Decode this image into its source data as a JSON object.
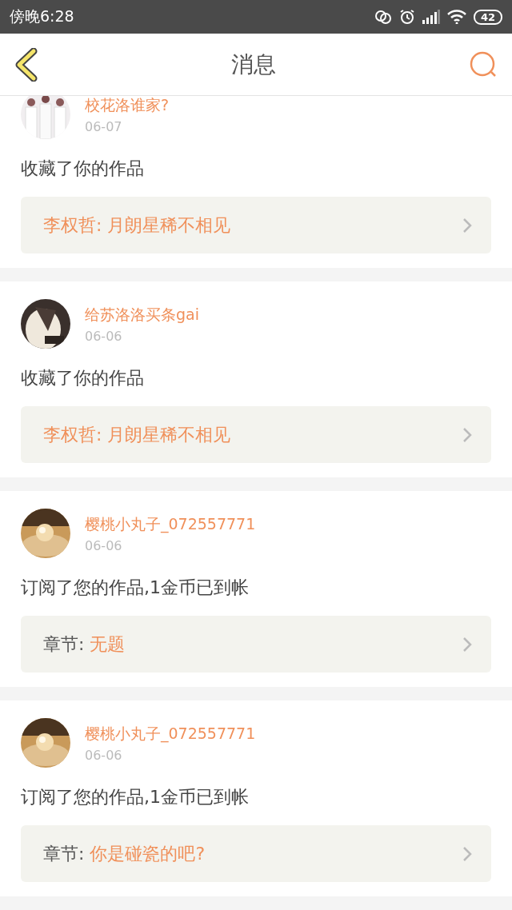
{
  "status_bar": {
    "time": "傍晚6:28",
    "battery": "42"
  },
  "header": {
    "title": "消息"
  },
  "messages": [
    {
      "user": "校花洛谁家?",
      "date": "06-07",
      "action": "收藏了你的作品",
      "ref": {
        "kind": "author",
        "label": "李权哲:",
        "title": "月朗星稀不相见"
      }
    },
    {
      "user": "给苏洛洛买条gai",
      "date": "06-06",
      "action": "收藏了你的作品",
      "ref": {
        "kind": "author",
        "label": "李权哲:",
        "title": "月朗星稀不相见"
      }
    },
    {
      "user": "樱桃小丸子_072557771",
      "date": "06-06",
      "action": "订阅了您的作品,1金币已到帐",
      "ref": {
        "kind": "chapter",
        "label": "章节:",
        "title": "无题"
      }
    },
    {
      "user": "樱桃小丸子_072557771",
      "date": "06-06",
      "action": "订阅了您的作品,1金币已到帐",
      "ref": {
        "kind": "chapter",
        "label": "章节:",
        "title": "你是碰瓷的吧?"
      }
    }
  ]
}
